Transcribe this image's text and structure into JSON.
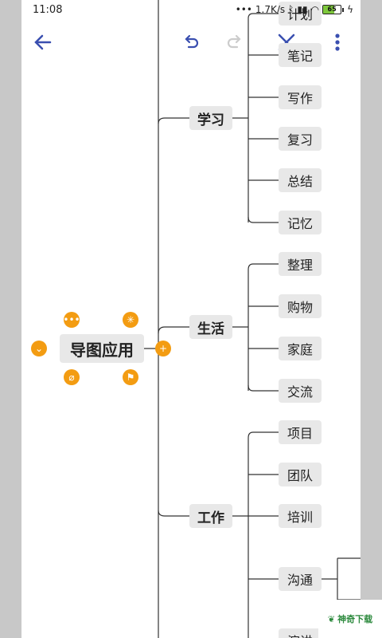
{
  "status_bar": {
    "time": "11:08",
    "network_speed": "1.7K/s",
    "battery": "65"
  },
  "toolbar": {
    "back_icon": "arrow-left-icon",
    "undo_icon": "undo-icon",
    "redo_icon": "redo-icon",
    "close_icon": "close-icon",
    "more_icon": "more-vertical-icon",
    "accent": "#3a4fb0"
  },
  "mindmap": {
    "root": "导图应用",
    "branches": [
      {
        "label": "学习",
        "children": [
          "计划",
          "笔记",
          "写作",
          "复习",
          "总结",
          "记忆"
        ]
      },
      {
        "label": "生活",
        "children": [
          "整理",
          "购物",
          "家庭",
          "交流"
        ]
      },
      {
        "label": "工作",
        "children": [
          "项目",
          "团队",
          "培训",
          "沟通",
          "演讲"
        ]
      }
    ]
  },
  "node_actions": {
    "color": "#f39c12",
    "icons": [
      "more-icon",
      "asterisk-icon",
      "collapse-icon",
      "add-icon",
      "attachment-icon",
      "flag-icon"
    ]
  },
  "watermark": "神奇下载"
}
